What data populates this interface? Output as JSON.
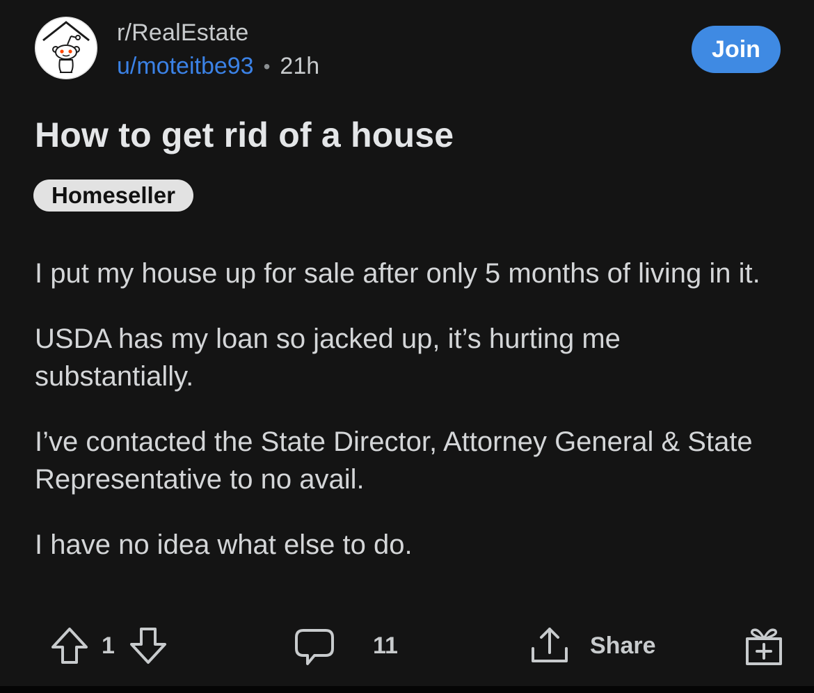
{
  "header": {
    "subreddit": "r/RealEstate",
    "username": "u/moteitbe93",
    "separator": "•",
    "age": "21h",
    "join_label": "Join",
    "avatar_icon": "reddit-snoo-icon"
  },
  "post": {
    "title": "How to get rid of a house",
    "flair": "Homeseller",
    "paragraphs": [
      "I put my house up for sale after only 5 months of living in it.",
      "USDA has my loan so jacked up, it’s hurting me substantially.",
      "I’ve contacted the State Director, Attorney General & State Representative to no avail.",
      "I have no idea what else to do."
    ]
  },
  "actions": {
    "upvote_icon": "upvote-arrow-icon",
    "vote_count": "1",
    "downvote_icon": "downvote-arrow-icon",
    "comment_icon": "comment-bubble-icon",
    "comment_count": "11",
    "share_icon": "share-icon",
    "share_label": "Share",
    "award_icon": "award-gift-icon"
  },
  "colors": {
    "background": "#141414",
    "username": "#3b82e6",
    "join_button": "#3f8ae3",
    "flair_bg": "#e2e2e2"
  }
}
